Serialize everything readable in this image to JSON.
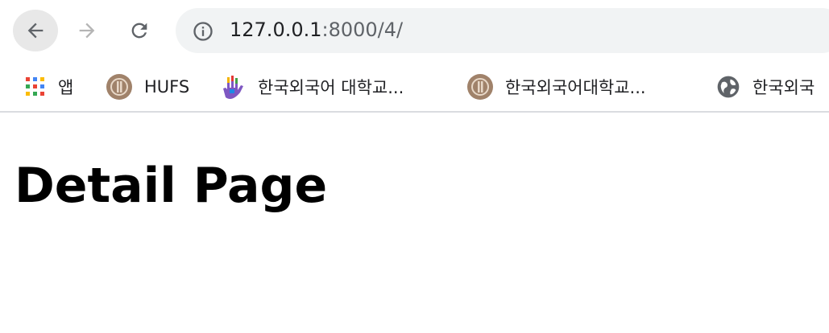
{
  "browser": {
    "url_host": "127.0.0.1",
    "url_path": ":8000/4/"
  },
  "bookmarks": [
    {
      "label": "앱",
      "icon": "apps-grid-icon"
    },
    {
      "label": "HUFS",
      "icon": "hufs-emblem-icon"
    },
    {
      "label": "한국외국어 대학교...",
      "icon": "colorful-hand-icon"
    },
    {
      "label": "한국외국어대학교...",
      "icon": "hufs-emblem-icon"
    },
    {
      "label": "한국외국",
      "icon": "globe-icon"
    }
  ],
  "page": {
    "heading": "Detail Page"
  },
  "colors": {
    "omnibox_bg": "#f1f3f4",
    "emblem": "#a0826a",
    "text": "#202124"
  }
}
